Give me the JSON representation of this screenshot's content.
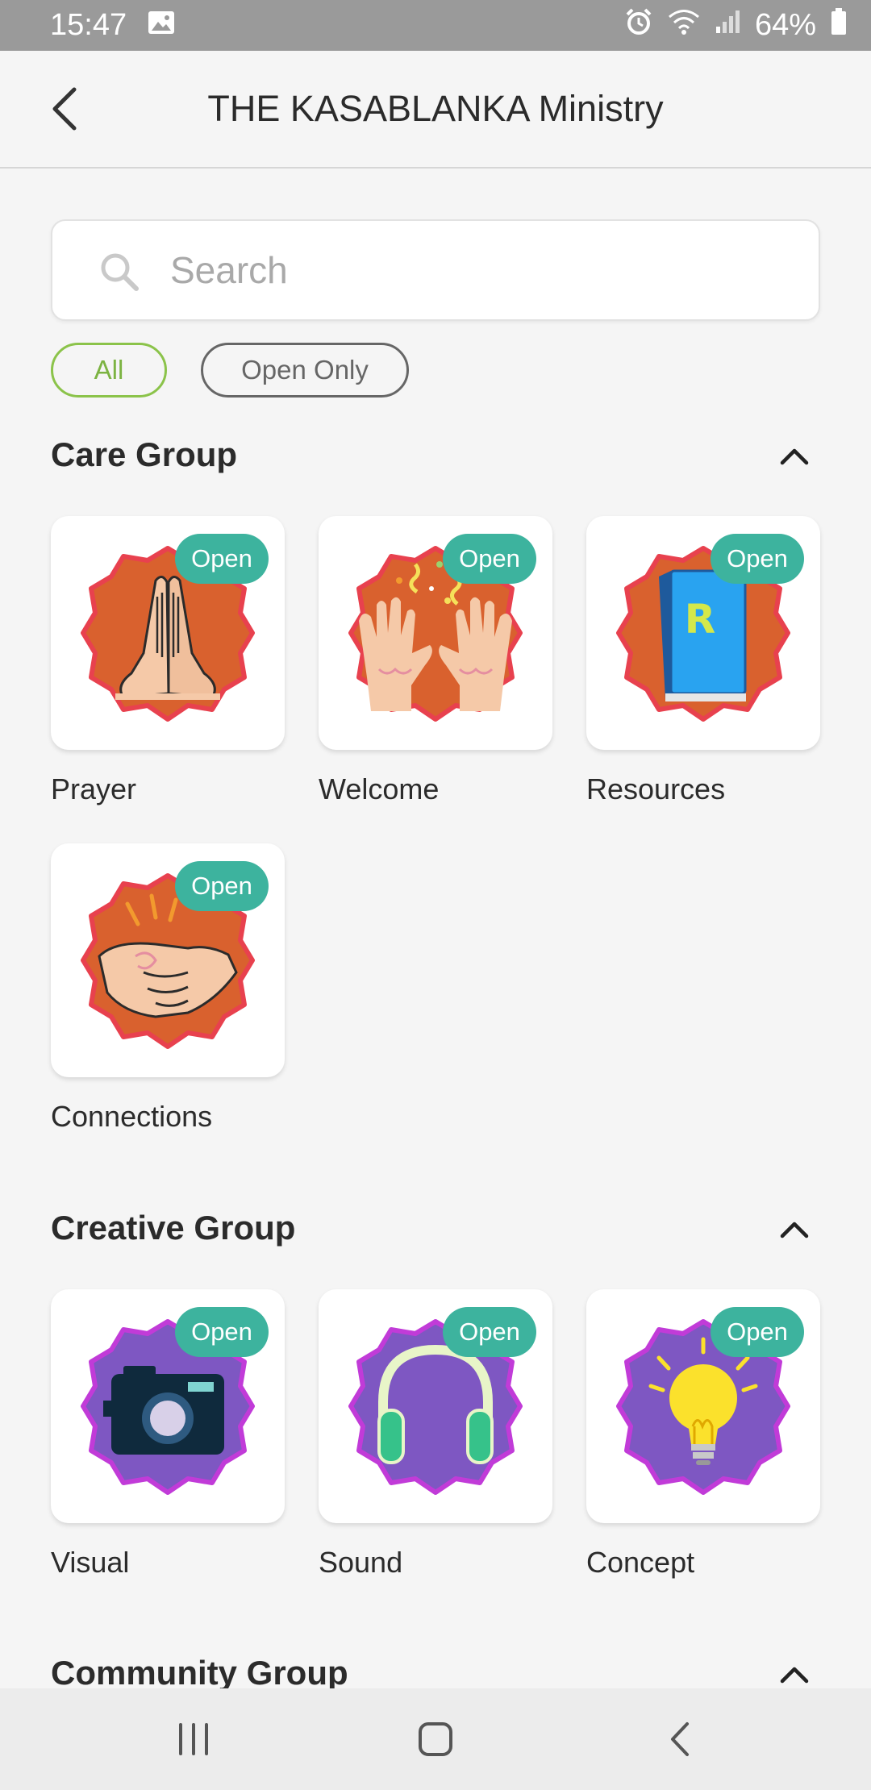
{
  "status_bar": {
    "time": "15:47",
    "battery": "64%"
  },
  "header": {
    "title": "THE KASABLANKA Ministry"
  },
  "search": {
    "placeholder": "Search"
  },
  "filters": {
    "all": "All",
    "open_only": "Open Only"
  },
  "badge_label": "Open",
  "sections": [
    {
      "title": "Care Group",
      "items": [
        {
          "label": "Prayer"
        },
        {
          "label": "Welcome"
        },
        {
          "label": "Resources"
        },
        {
          "label": "Connections"
        }
      ]
    },
    {
      "title": "Creative Group",
      "items": [
        {
          "label": "Visual"
        },
        {
          "label": "Sound"
        },
        {
          "label": "Concept"
        }
      ]
    },
    {
      "title": "Community Group",
      "items": []
    }
  ],
  "colors": {
    "accent": "#8bc34a",
    "badge": "#3db39e",
    "care_badge_bg": "#d9612e",
    "creative_badge_bg": "#7e57c2"
  },
  "icons": [
    "back-arrow-icon",
    "search-icon",
    "chevron-up-icon",
    "praying-hands-icon",
    "raised-hands-icon",
    "book-icon",
    "handshake-icon",
    "camera-icon",
    "headphones-icon",
    "lightbulb-icon"
  ]
}
